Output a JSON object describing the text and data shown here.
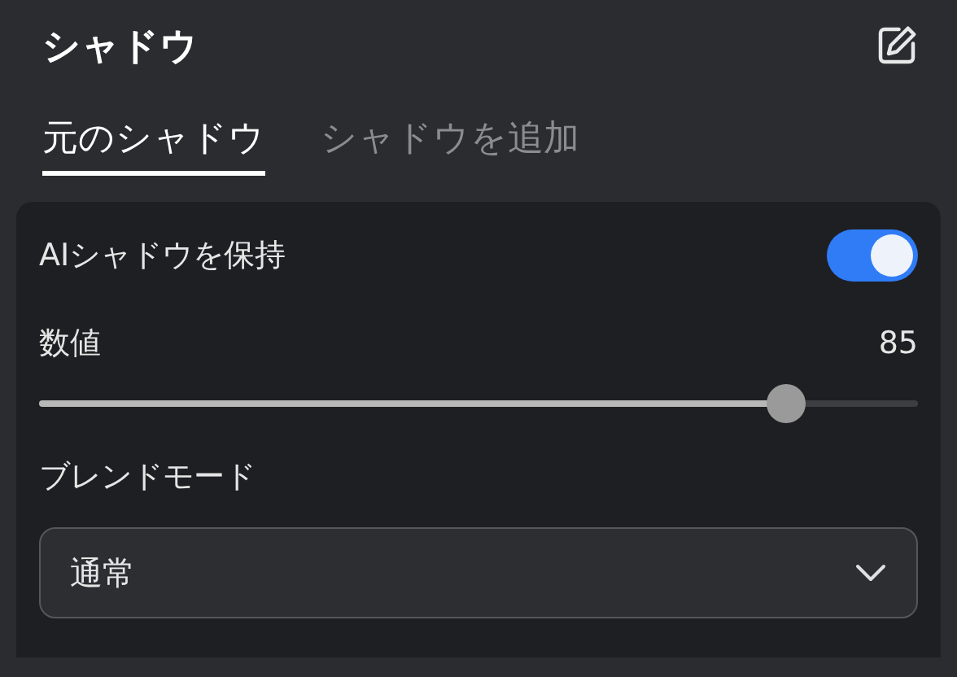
{
  "header": {
    "title": "シャドウ"
  },
  "tabs": [
    {
      "label": "元のシャドウ",
      "selected": true
    },
    {
      "label": "シャドウを追加",
      "selected": false
    }
  ],
  "panel": {
    "toggle": {
      "label": "AIシャドウを保持",
      "on": true
    },
    "slider": {
      "label": "数値",
      "reading": "85",
      "level": 0.85
    },
    "blend": {
      "label": "ブレンドモード",
      "value": "通常"
    }
  }
}
